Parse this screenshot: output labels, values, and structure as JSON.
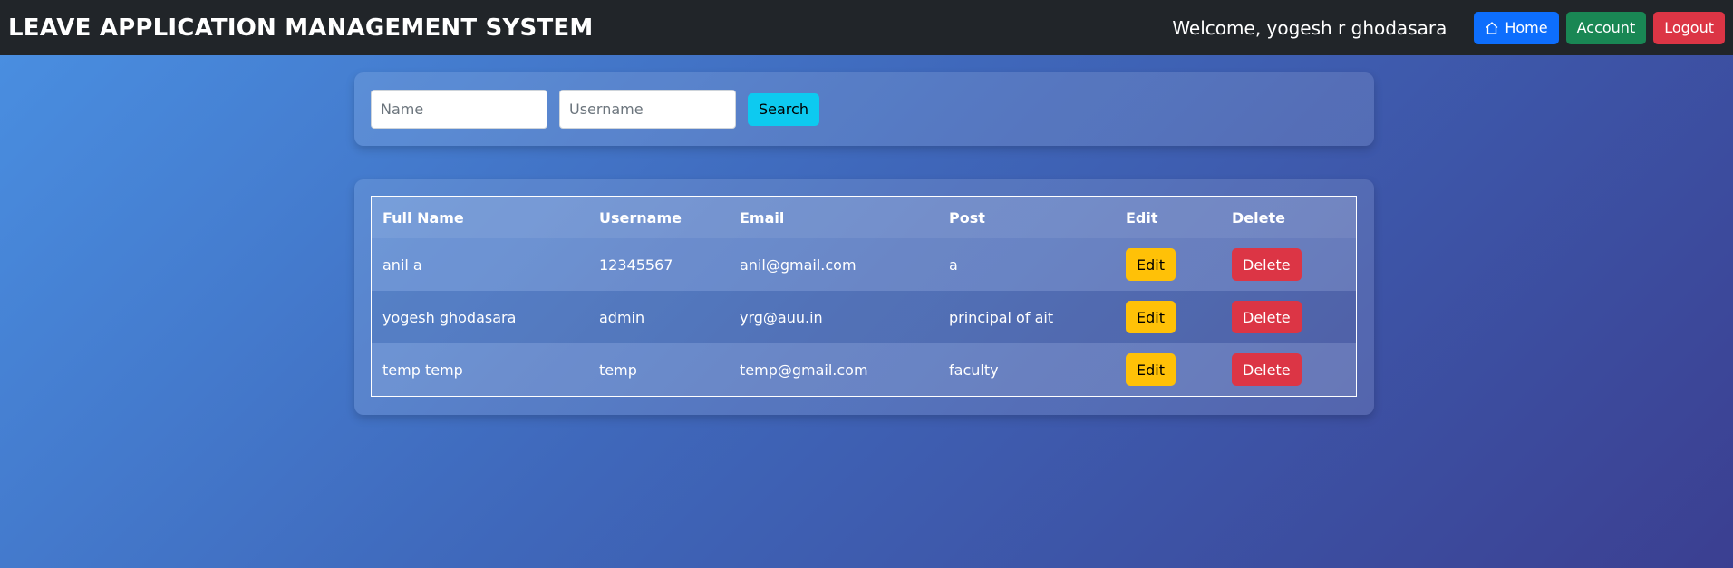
{
  "header": {
    "title": "LEAVE APPLICATION MANAGEMENT SYSTEM",
    "welcome": "Welcome, yogesh r ghodasara",
    "home_label": "Home",
    "home_icon": "home-icon",
    "account_label": "Account",
    "logout_label": "Logout"
  },
  "search": {
    "name_placeholder": "Name",
    "username_placeholder": "Username",
    "button_label": "Search"
  },
  "table": {
    "headers": [
      "Full Name",
      "Username",
      "Email",
      "Post",
      "Edit",
      "Delete"
    ],
    "rows": [
      {
        "full_name": "anil a",
        "username": "12345567",
        "email": "anil@gmail.com",
        "post": "a",
        "edit": "Edit",
        "delete": "Delete"
      },
      {
        "full_name": "yogesh ghodasara",
        "username": "admin",
        "email": "yrg@auu.in",
        "post": "principal of ait",
        "edit": "Edit",
        "delete": "Delete"
      },
      {
        "full_name": "temp temp",
        "username": "temp",
        "email": "temp@gmail.com",
        "post": "faculty",
        "edit": "Edit",
        "delete": "Delete"
      }
    ]
  },
  "colors": {
    "navbar": "#212529",
    "home_button": "#0d6efd",
    "account_button": "#198754",
    "logout_button": "#dc3545",
    "search_button": "#0dcaf0",
    "edit_button": "#ffc107",
    "delete_button": "#dc3545"
  }
}
